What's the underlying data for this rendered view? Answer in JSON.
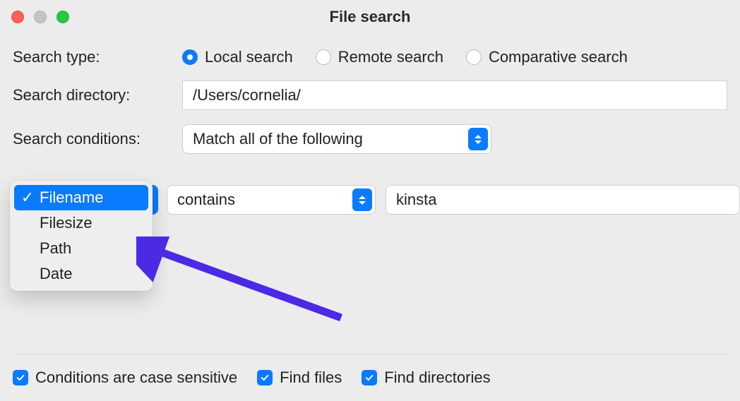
{
  "window": {
    "title": "File search"
  },
  "form": {
    "search_type_label": "Search type:",
    "search_directory_label": "Search directory:",
    "search_conditions_label": "Search conditions:",
    "directory_value": "/Users/cornelia/",
    "conditions_mode": "Match all of the following",
    "radio_options": {
      "local": "Local search",
      "remote": "Remote search",
      "comparative": "Comparative search"
    }
  },
  "condition": {
    "operator": "contains",
    "value": "kinsta"
  },
  "dropdown": {
    "items": [
      "Filename",
      "Filesize",
      "Path",
      "Date"
    ],
    "selected": "Filename"
  },
  "footer": {
    "case_sensitive": "Conditions are case sensitive",
    "find_files": "Find files",
    "find_directories": "Find directories"
  }
}
